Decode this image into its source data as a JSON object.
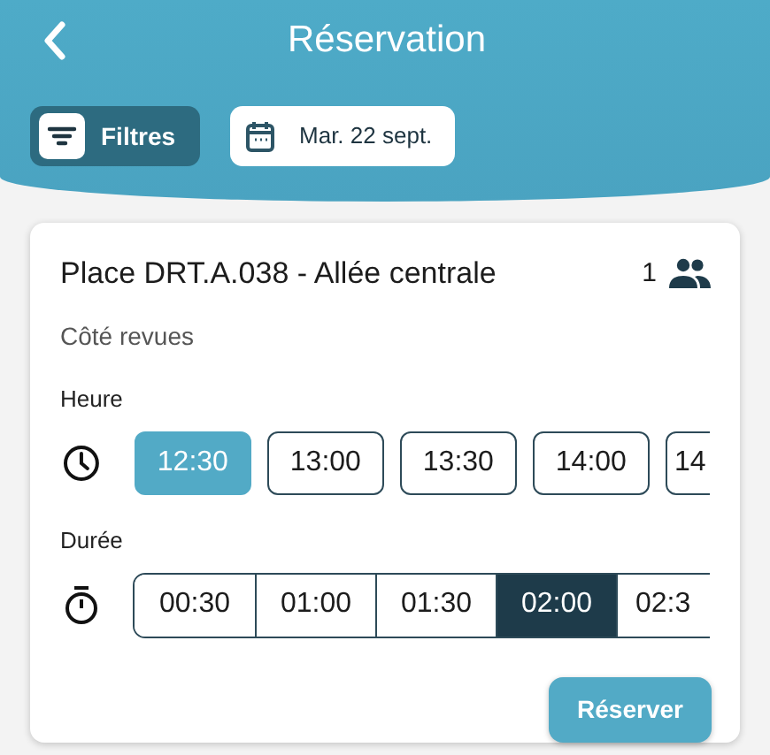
{
  "header": {
    "title": "Réservation"
  },
  "filters": {
    "label": "Filtres"
  },
  "date": {
    "label": "Mar. 22 sept."
  },
  "place": {
    "title": "Place DRT.A.038  - Allée centrale",
    "capacity": "1",
    "subtitle": "Côté revues"
  },
  "hours": {
    "label": "Heure",
    "options": [
      {
        "text": "12:30",
        "selected": true,
        "clipped": false
      },
      {
        "text": "13:00",
        "selected": false,
        "clipped": false
      },
      {
        "text": "13:30",
        "selected": false,
        "clipped": false
      },
      {
        "text": "14:00",
        "selected": false,
        "clipped": false
      },
      {
        "text": "14",
        "selected": false,
        "clipped": true
      }
    ]
  },
  "durations": {
    "label": "Durée",
    "options": [
      {
        "text": "00:30",
        "selected": false,
        "clipped": false
      },
      {
        "text": "01:00",
        "selected": false,
        "clipped": false
      },
      {
        "text": "01:30",
        "selected": false,
        "clipped": false
      },
      {
        "text": "02:00",
        "selected": true,
        "clipped": false
      },
      {
        "text": "02:3",
        "selected": false,
        "clipped": true
      }
    ]
  },
  "submit": {
    "label": "Réserver"
  }
}
